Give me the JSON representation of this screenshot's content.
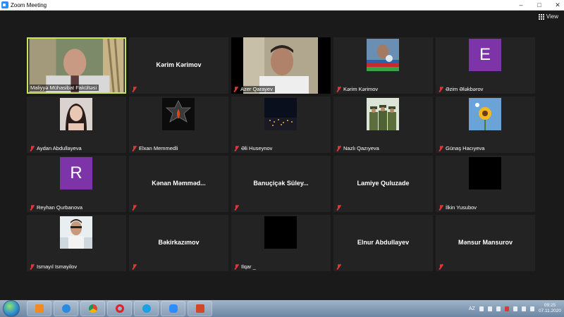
{
  "window": {
    "title": "Zoom Meeting"
  },
  "toolbar": {
    "view_label": "View"
  },
  "participants": [
    {
      "name": "Maliyyə Mühasibat Fakültəsi",
      "kind": "video"
    },
    {
      "name": "Kərim Kərimov",
      "kind": "name"
    },
    {
      "name": "Azer Qarayev",
      "kind": "video"
    },
    {
      "name": "Kərim Kərimov",
      "kind": "photo"
    },
    {
      "name": "Əzim Ələkbərov",
      "kind": "letter",
      "letter": "E"
    },
    {
      "name": "Aydan Abdullayeva",
      "kind": "photo"
    },
    {
      "name": "Elxan Memmedli",
      "kind": "photo"
    },
    {
      "name": "Əli Huseynov",
      "kind": "photo"
    },
    {
      "name": "Nazlı Qazıyeva",
      "kind": "photo"
    },
    {
      "name": "Günaş Hacıyeva",
      "kind": "photo"
    },
    {
      "name": "Reyhan Qurbanova",
      "kind": "letter",
      "letter": "R"
    },
    {
      "name": "Kənan  Məmməd...",
      "kind": "name"
    },
    {
      "name": "Banuçiçək  Süley...",
      "kind": "name"
    },
    {
      "name": "Lamiye Quluzade",
      "kind": "name"
    },
    {
      "name": "İlkin Yusubov",
      "kind": "black"
    },
    {
      "name": "Ismayıl Ismayilov",
      "kind": "photo"
    },
    {
      "name": "Bəkirkazımov",
      "kind": "name"
    },
    {
      "name": "Ilqar _",
      "kind": "black"
    },
    {
      "name": "Elnur Abdullayev",
      "kind": "name"
    },
    {
      "name": "Mənsur Mansurov",
      "kind": "name"
    }
  ],
  "taskbar": {
    "language": "AZ",
    "time": "09:25",
    "date": "07.11.2020"
  },
  "colors": {
    "background": "#1a1a1a",
    "tile": "#232323",
    "active_speaker_border": "#c9e35a",
    "mic_muted": "#e0353a",
    "avatar_purple": "#7d34a8"
  }
}
